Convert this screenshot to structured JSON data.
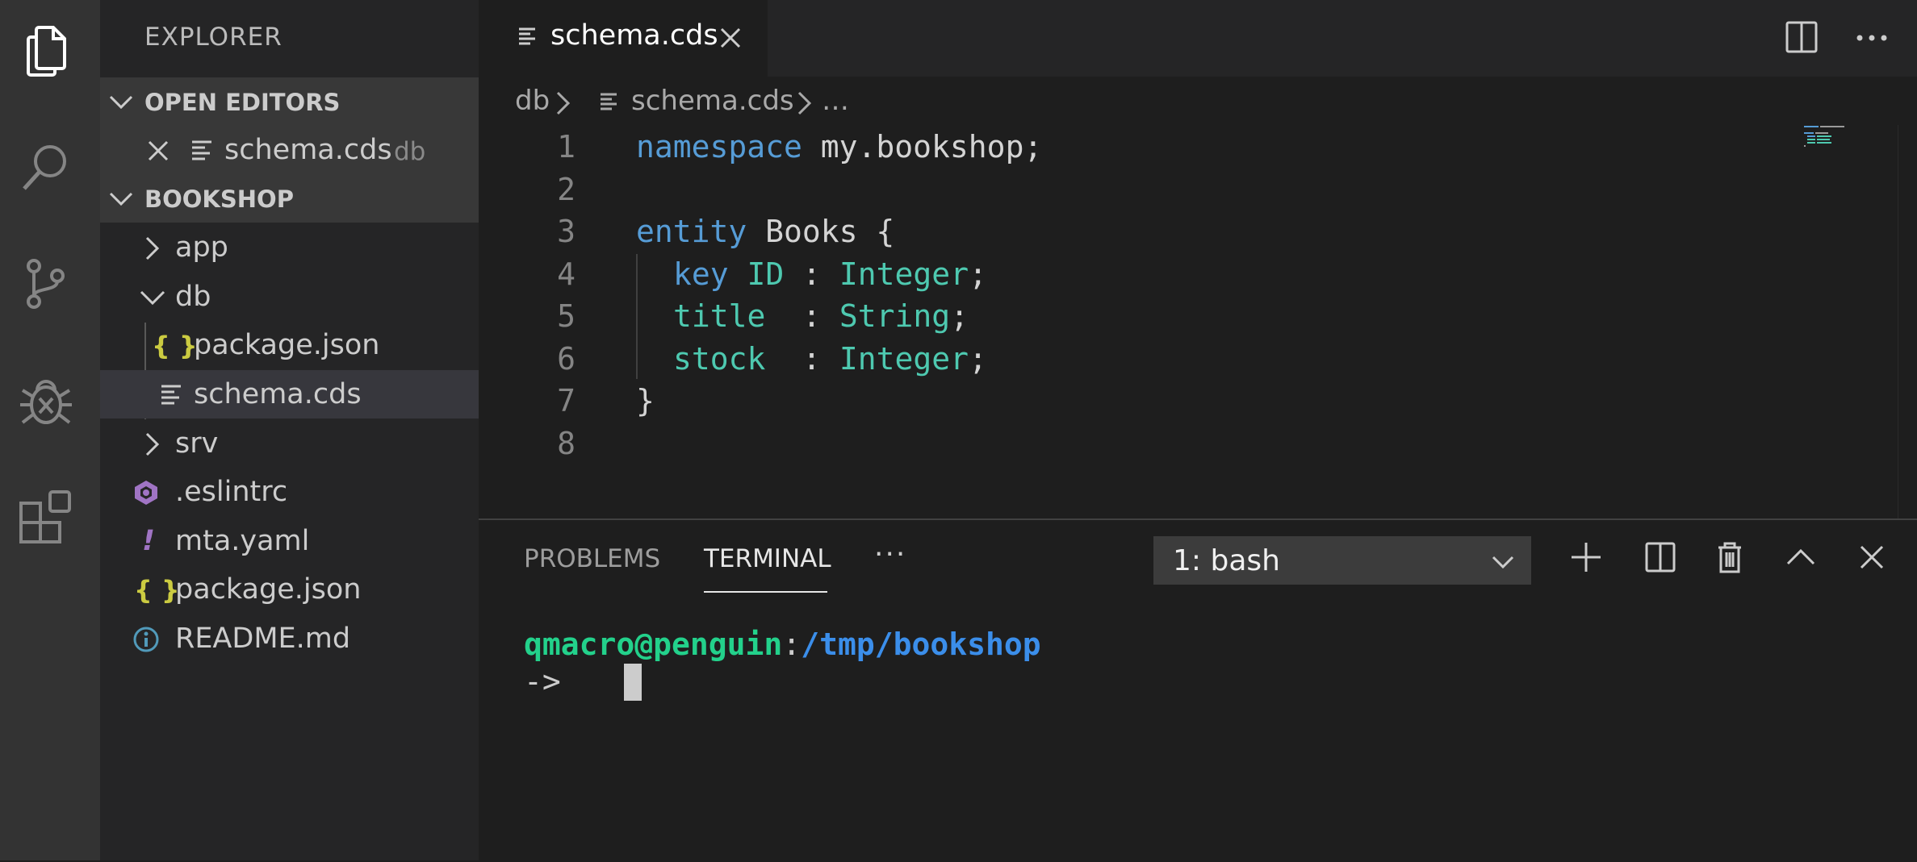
{
  "activity_bar": {
    "icons": [
      "files-icon",
      "search-icon",
      "source-control-icon",
      "debug-icon",
      "extensions-icon"
    ]
  },
  "sidebar": {
    "title": "EXPLORER",
    "open_editors": {
      "header": "OPEN EDITORS",
      "items": [
        {
          "name": "schema.cds",
          "folder": "db"
        }
      ]
    },
    "project": {
      "header": "BOOKSHOP",
      "tree": [
        {
          "label": "app",
          "type": "folder",
          "expanded": false
        },
        {
          "label": "db",
          "type": "folder",
          "expanded": true
        },
        {
          "label": "package.json",
          "type": "json"
        },
        {
          "label": "schema.cds",
          "type": "cds",
          "selected": true
        },
        {
          "label": "srv",
          "type": "folder",
          "expanded": false
        },
        {
          "label": ".eslintrc",
          "type": "eslint"
        },
        {
          "label": "mta.yaml",
          "type": "yaml"
        },
        {
          "label": "package.json",
          "type": "json"
        },
        {
          "label": "README.md",
          "type": "info"
        }
      ]
    }
  },
  "tabs": [
    {
      "label": "schema.cds",
      "active": true
    }
  ],
  "breadcrumb": {
    "folder": "db",
    "file": "schema.cds",
    "more": "…"
  },
  "editor": {
    "line_numbers": [
      "1",
      "2",
      "3",
      "4",
      "5",
      "6",
      "7",
      "8"
    ],
    "tokens": {
      "l1_kw": "namespace",
      "l1_rest": " my.bookshop;",
      "l3_kw": "entity",
      "l3_rest": " Books {",
      "l4_key": "key",
      "l4_id": " ID",
      "l4_colon": " : ",
      "l4_type": "Integer",
      "l4_end": ";",
      "l5_name": "title",
      "l5_colon": "  : ",
      "l5_type": "String",
      "l5_end": ";",
      "l6_name": "stock",
      "l6_colon": "  : ",
      "l6_type": "Integer",
      "l6_end": ";",
      "l7": "}"
    }
  },
  "panel": {
    "tabs": [
      "PROBLEMS",
      "TERMINAL"
    ],
    "active_tab": "TERMINAL",
    "more": "···",
    "terminal_select": "1: bash",
    "terminal": {
      "user_host": "qmacro@penguin",
      "separator": ":",
      "path": "/tmp/bookshop",
      "prompt": "->"
    }
  },
  "colors": {
    "keyword": "#569cd6",
    "type": "#4ec9b0",
    "terminal_user": "#23d18b",
    "terminal_path": "#3b8eea",
    "json_icon": "#cbcb41",
    "eslint_icon": "#a074c4",
    "info_icon": "#519aba"
  }
}
